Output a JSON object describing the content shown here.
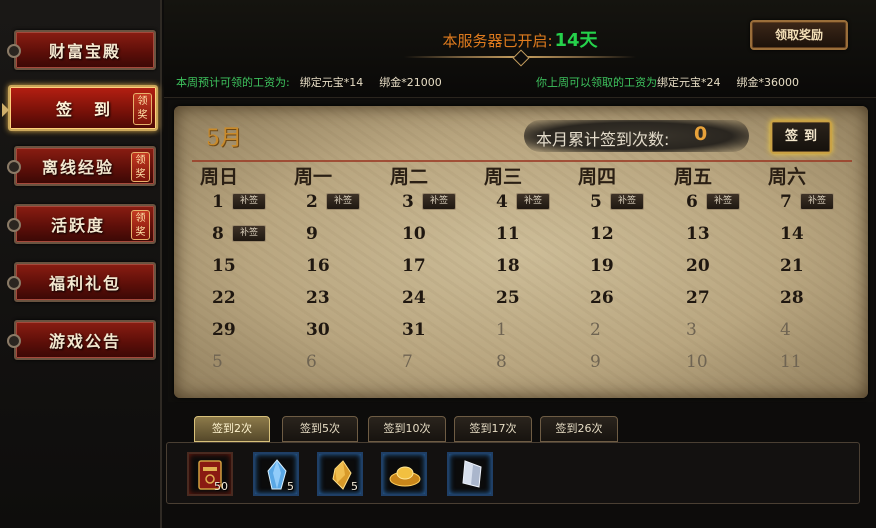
{
  "sidebar": {
    "items": [
      {
        "label": "财富宝殿",
        "badge": ""
      },
      {
        "label": "签到",
        "badge": "领奖"
      },
      {
        "label": "离线经验",
        "badge": "领奖"
      },
      {
        "label": "活跃度",
        "badge": "领奖"
      },
      {
        "label": "福利礼包",
        "badge": ""
      },
      {
        "label": "游戏公告",
        "badge": ""
      }
    ],
    "active_index": 1
  },
  "header": {
    "server_open_label": "本服务器已开启:",
    "server_days": "14天",
    "claim_button": "领取奖励",
    "this_week": {
      "label": "本周预计可领的工资为:",
      "item1": "绑定元宝*14",
      "item2": "绑金*21000"
    },
    "last_week": {
      "label": "你上周可以领取的工资为",
      "item1": "绑定元宝*24",
      "item2": "绑金*36000"
    }
  },
  "calendar": {
    "month": "5月",
    "count_label": "本月累计签到次数:",
    "count_value": "0",
    "signin_button": "签到",
    "makeup_label": "补签",
    "weekdays": [
      "周日",
      "周一",
      "周二",
      "周三",
      "周四",
      "周五",
      "周六"
    ],
    "rows": [
      [
        "1",
        "2",
        "3",
        "4",
        "5",
        "6",
        "7"
      ],
      [
        "8",
        "9",
        "10",
        "11",
        "12",
        "13",
        "14"
      ],
      [
        "15",
        "16",
        "17",
        "18",
        "19",
        "20",
        "21"
      ],
      [
        "22",
        "23",
        "24",
        "25",
        "26",
        "27",
        "28"
      ],
      [
        "29",
        "30",
        "31",
        "1",
        "2",
        "3",
        "4"
      ],
      [
        "5",
        "6",
        "7",
        "8",
        "9",
        "10",
        "11"
      ]
    ],
    "makeup_days": [
      "1",
      "2",
      "3",
      "4",
      "5",
      "6",
      "7",
      "8"
    ]
  },
  "rewards": {
    "tabs": [
      "签到2次",
      "签到5次",
      "签到10次",
      "签到17次",
      "签到26次"
    ],
    "active_tab": 0,
    "items": [
      {
        "icon": "red-book-icon",
        "qty": "50"
      },
      {
        "icon": "blue-crystal-icon",
        "qty": "5"
      },
      {
        "icon": "gold-crystal-icon",
        "qty": "5"
      },
      {
        "icon": "gold-ingot-icon",
        "qty": ""
      },
      {
        "icon": "white-crystal-icon",
        "qty": ""
      }
    ]
  },
  "colors": {
    "accent_green": "#25d14b",
    "accent_orange": "#e07b1e",
    "nav_red": "#8a1d12"
  }
}
